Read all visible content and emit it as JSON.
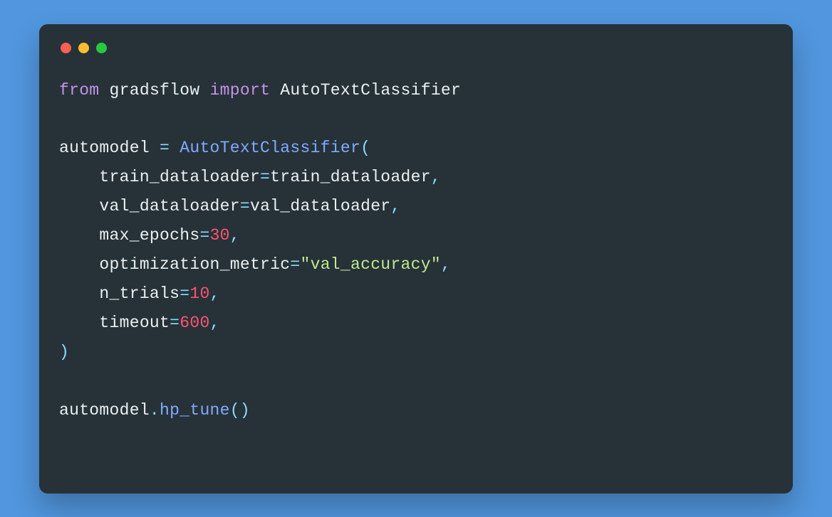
{
  "window": {
    "dot_colors": {
      "close": "#ff5f56",
      "minimize": "#ffbd2e",
      "zoom": "#27c93f"
    }
  },
  "code": {
    "line1": {
      "from": "from",
      "module": "gradsflow",
      "import": "import",
      "symbol": "AutoTextClassifier"
    },
    "line2": "",
    "line3": {
      "lhs": "automodel",
      "assign": " = ",
      "cls": "AutoTextClassifier",
      "open": "("
    },
    "line4": {
      "indent": "    ",
      "kw": "train_dataloader",
      "eq": "=",
      "val": "train_dataloader",
      "comma": ","
    },
    "line5": {
      "indent": "    ",
      "kw": "val_dataloader",
      "eq": "=",
      "val": "val_dataloader",
      "comma": ","
    },
    "line6": {
      "indent": "    ",
      "kw": "max_epochs",
      "eq": "=",
      "val": "30",
      "comma": ","
    },
    "line7": {
      "indent": "    ",
      "kw": "optimization_metric",
      "eq": "=",
      "val": "\"val_accuracy\"",
      "comma": ","
    },
    "line8": {
      "indent": "    ",
      "kw": "n_trials",
      "eq": "=",
      "val": "10",
      "comma": ","
    },
    "line9": {
      "indent": "    ",
      "kw": "timeout",
      "eq": "=",
      "val": "600",
      "comma": ","
    },
    "line10": {
      "close": ")"
    },
    "line11": "",
    "line12": {
      "obj": "automodel",
      "dot": ".",
      "method": "hp_tune",
      "parens": "()"
    }
  }
}
